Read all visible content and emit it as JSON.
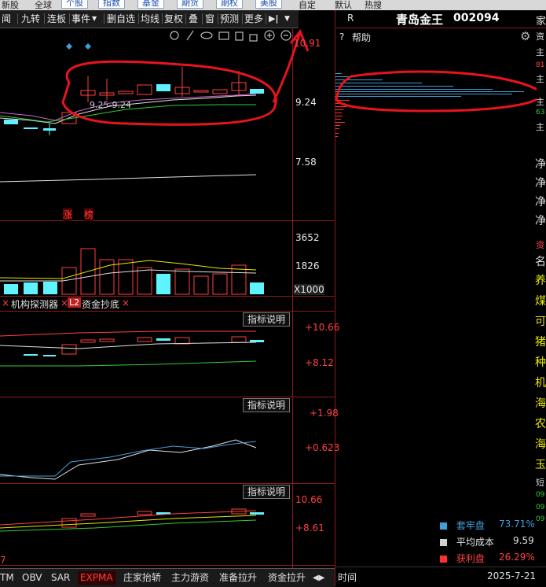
{
  "top_nav": [
    "新股",
    "全球",
    "个股",
    "指数",
    "基金",
    "期货",
    "期权",
    "美股",
    "自定",
    "默认",
    "热搜"
  ],
  "toolbar": {
    "items": [
      "闻",
      "九转",
      "连板",
      "事件",
      "删自选",
      "均线",
      "复权",
      "叠",
      "窗",
      "预测",
      "更多"
    ],
    "play_icon": "▶|",
    "dropdown_icon": "▼",
    "event_dropdown": "▼"
  },
  "right_header": {
    "r_label": "R",
    "stock_name": "青岛金王",
    "stock_code": "002094",
    "side_label": "家"
  },
  "help_label": "帮助",
  "main_chart": {
    "price_ticks": [
      "10.91",
      "9.24",
      "7.58"
    ],
    "annotation": "9.25-9.24",
    "tags": [
      "涨",
      "榜"
    ],
    "volume_ticks": [
      "3652",
      "1826"
    ],
    "volume_unit": "X1000"
  },
  "volume_tabs": [
    "机构探测器",
    "资金抄底"
  ],
  "volume_tab_badge": "L2",
  "indicator_button": "指标说明",
  "panel1_ticks": [
    "+10.66",
    "+8.12"
  ],
  "panel2_ticks": [
    "+1.98",
    "+0.623"
  ],
  "panel3_ticks": [
    "10.66",
    "+8.61"
  ],
  "bottom_left_label": "7",
  "bottom_tabs": [
    "TM",
    "OBV",
    "SAR",
    "EXPMA",
    "庄家抬轿",
    "主力游资",
    "准备拉升",
    "资金拉升"
  ],
  "bottom_tabs_more": "◀▶",
  "right_strip": {
    "items": [
      "资",
      "主",
      "81",
      "主",
      "主",
      "63",
      "主",
      "净",
      "净",
      "净",
      "净",
      "资",
      "名",
      "养",
      "煤",
      "可",
      "猪",
      "种",
      "机",
      "海",
      "农",
      "海",
      "玉",
      "短",
      "09",
      "09",
      "09"
    ]
  },
  "chip_legend": [
    {
      "label": "套牢盘",
      "value": "73.71%",
      "color": "#3fa0d8"
    },
    {
      "label": "平均成本",
      "value": "9.59",
      "color": "#d0d0d0"
    },
    {
      "label": "获利盘",
      "value": "26.29%",
      "color": "#ff3030"
    }
  ],
  "time_label": "时间",
  "date_label": "2025-7-21",
  "colors": {
    "up": "#ff4040",
    "down": "#5ff3ff",
    "divider": "#8b1a1a",
    "annotation_stroke": "#e8141c"
  }
}
